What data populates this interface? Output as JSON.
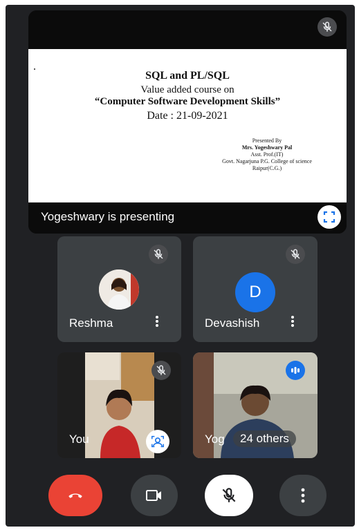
{
  "slide": {
    "title": "SQL and PL/SQL",
    "line2": "Value added course on",
    "line3": "“Computer Software Development Skills”",
    "line4": "Date : 21-09-2021",
    "presented_by": "Presented By",
    "presenter_name": "Mrs. Yogeshwary Pal",
    "presenter_role": "Asst. Prof.(IT)",
    "presenter_college": "Govt. Nagarjuna P.G. College of science",
    "presenter_city": "Raipur(C.G.)"
  },
  "presentation": {
    "status_text": "Yogeshwary is presenting",
    "fullscreen_icon": "fullscreen-icon",
    "mute_icon": "mic-off-icon"
  },
  "participants": [
    {
      "name": "Reshma",
      "avatar": "photo",
      "muted": true
    },
    {
      "name": "Devashish",
      "avatar_letter": "D",
      "avatar_color": "#1a73e8",
      "muted": true
    },
    {
      "name": "You",
      "muted": true,
      "effect_icon": "visual-effects-icon"
    },
    {
      "name": "Yog",
      "overlay": "24 others",
      "speaking_icon": "audio-level-icon"
    }
  ],
  "controls": [
    {
      "name": "leave-call",
      "icon": "hang-up-icon",
      "color": "#ea4335"
    },
    {
      "name": "camera",
      "icon": "camera-icon",
      "color": "#3c4043"
    },
    {
      "name": "microphone",
      "icon": "mic-off-icon",
      "color": "#ffffff"
    },
    {
      "name": "more-options",
      "icon": "more-vert-icon",
      "color": "#3c4043"
    }
  ]
}
